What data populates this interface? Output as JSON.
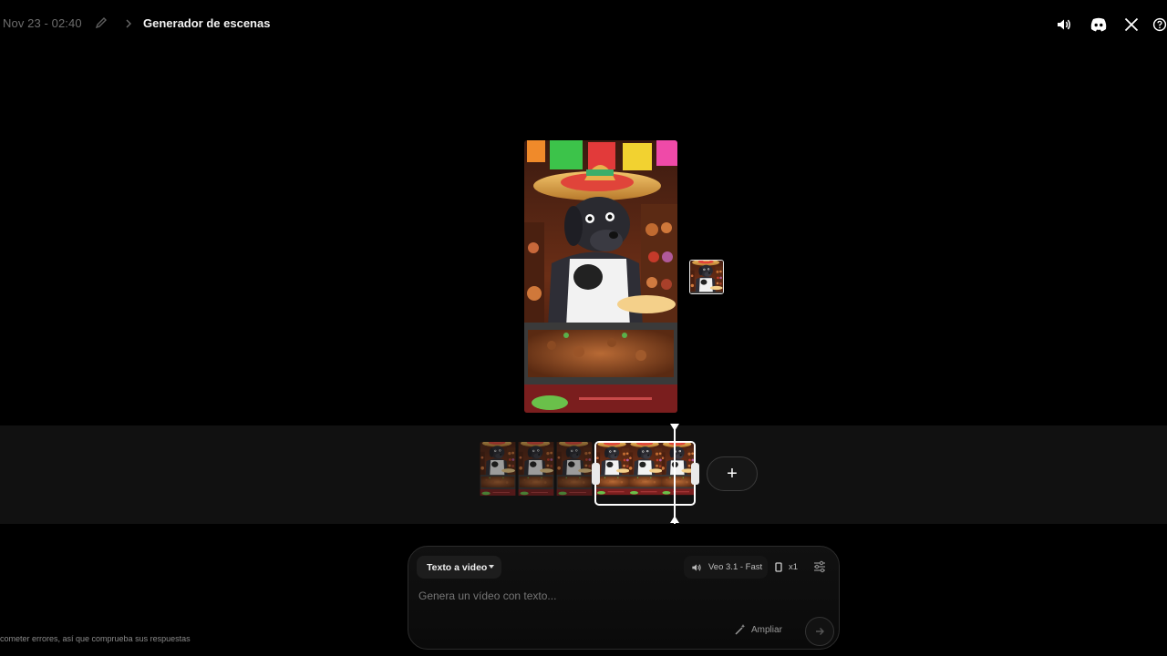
{
  "header": {
    "date_label": "Nov 23 - 02:40",
    "title": "Generador de escenas",
    "icons": [
      "pencil-icon",
      "chevron-right-icon",
      "speaker-icon",
      "discord-icon",
      "x-logo-icon",
      "help-icon"
    ]
  },
  "timeline": {
    "add_label": "+"
  },
  "composer": {
    "mode_label": "Texto a video",
    "model_label": "Veo 3.1 - Fast",
    "count_label": "x1",
    "placeholder": "Genera un vídeo con texto...",
    "expand_label": "Ampliar"
  },
  "footer": {
    "disclaimer": "cometer errores, así que comprueba sus respuestas"
  },
  "colors": {
    "background": "#000000",
    "timeline_bg": "#111111",
    "text_muted": "#6d6d6d",
    "accent_white": "#ffffff"
  }
}
